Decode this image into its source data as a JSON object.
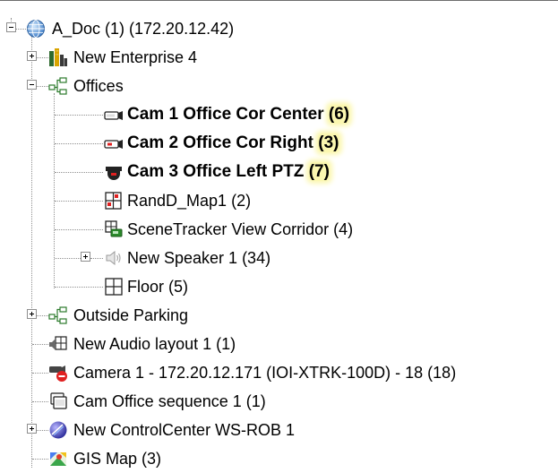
{
  "tree": {
    "root": {
      "name": "A_Doc (1) (172.20.12.42)",
      "icon": "globe-icon"
    },
    "items": [
      {
        "id": "new-enterprise-4",
        "label": "New Enterprise 4",
        "icon": "enterprise-building-icon",
        "expander": "collapsed"
      },
      {
        "id": "offices",
        "label": "Offices",
        "icon": "network-group-icon",
        "expander": "expanded"
      },
      {
        "id": "cam-1",
        "name": "Cam 1 Office Cor Center",
        "count": "(6)",
        "icon": "fixed-camera-icon",
        "highlighted": true
      },
      {
        "id": "cam-2",
        "name": "Cam 2 Office Cor Right",
        "count": "(3)",
        "icon": "fixed-camera-recording-icon",
        "highlighted": true
      },
      {
        "id": "cam-3",
        "name": "Cam 3 Office Left PTZ",
        "count": "(7)",
        "icon": "ptz-camera-icon",
        "highlighted": true
      },
      {
        "id": "randd-map1",
        "label": "RandD_Map1 (2)",
        "icon": "map-icon"
      },
      {
        "id": "scenetracker",
        "label": "SceneTracker View Corridor (4)",
        "icon": "scenetracker-icon"
      },
      {
        "id": "new-speaker-1",
        "label": "New Speaker 1 (34)",
        "icon": "speaker-icon",
        "expander": "collapsed"
      },
      {
        "id": "floor",
        "label": "Floor (5)",
        "icon": "floor-plan-icon"
      },
      {
        "id": "outside-parking",
        "label": "Outside Parking",
        "icon": "network-group-icon",
        "expander": "collapsed"
      },
      {
        "id": "new-audio-layout",
        "label": "New Audio layout 1 (1)",
        "icon": "audio-layout-icon"
      },
      {
        "id": "camera-1",
        "label": "Camera 1 - 172.20.12.171 (IOI-XTRK-100D) - 18 (18)",
        "icon": "camera-disabled-icon"
      },
      {
        "id": "cam-office-sequence",
        "label": "Cam Office sequence 1 (1)",
        "icon": "sequence-icon"
      },
      {
        "id": "new-controlcenter",
        "label": "New ControlCenter WS-ROB 1",
        "icon": "controlcenter-icon",
        "expander": "collapsed"
      },
      {
        "id": "gis-map",
        "label": "GIS Map (3)",
        "icon": "gis-map-icon"
      }
    ]
  },
  "colors": {
    "highlight": "#fbf7b0",
    "tree_lines": "#8f8f8f",
    "text": "#000000"
  }
}
